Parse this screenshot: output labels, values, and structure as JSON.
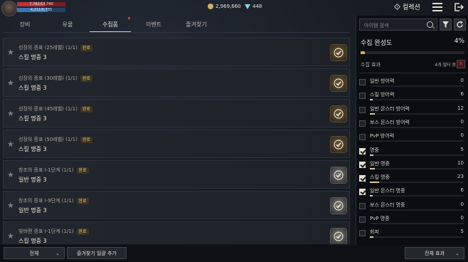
{
  "player": {
    "hp_text": "7,782/13,740",
    "mp_text": "4,211/6,735",
    "hp_ratio": 0.57,
    "mp_ratio": 0.63
  },
  "currency": {
    "gold": "2,969,660",
    "gems": "448"
  },
  "header": {
    "collection_label": "컬렉션"
  },
  "tabs": [
    {
      "label": "장비"
    },
    {
      "label": "유물"
    },
    {
      "label": "수집품",
      "active": true,
      "alert": true
    },
    {
      "label": "이벤트"
    },
    {
      "label": "즐겨찾기"
    }
  ],
  "items": [
    {
      "title": "성장의 증표 (25레벨) (1/1)",
      "badge": "완료",
      "effect": "스킬 명중 3",
      "icon": "gold"
    },
    {
      "title": "성장의 증표 (30레벨) (1/1)",
      "badge": "완료",
      "effect": "스킬 명중 3",
      "icon": "gold"
    },
    {
      "title": "성장의 증표 (45레벨) (1/1)",
      "badge": "완료",
      "effect": "스킬 명중 3",
      "icon": "gold"
    },
    {
      "title": "성장의 증표 (50레벨) (1/1)",
      "badge": "완료",
      "effect": "스킬 명중 3",
      "icon": "gold"
    },
    {
      "title": "창조의 증표 I-1단계 (1/1)",
      "badge": "완료",
      "effect": "일반 명중 3",
      "icon": "gray"
    },
    {
      "title": "창조의 증표 I-9단계 (1/1)",
      "badge": "완료",
      "effect": "일반 명중 3",
      "icon": "gray"
    },
    {
      "title": "빛바랜 증표 I-1단계 (1/1)",
      "badge": "완료",
      "effect": "스킬 명중 3",
      "icon": "gray"
    }
  ],
  "bottom": {
    "filter_all": "전체",
    "add_favorites": "즐겨찾기 일괄 추가",
    "all_effects": "전체 효과"
  },
  "panel": {
    "search_placeholder": "아이템 검색",
    "completion_label": "수집 완성도",
    "completion_pct": "4%",
    "completion_ratio": 0.04,
    "effects_label": "수집 효과",
    "filter_count_label": "4개 필터 중",
    "effects": [
      {
        "label": "일반 방어력",
        "value": "0",
        "checked": false,
        "ratio": 0
      },
      {
        "label": "스킬 방어력",
        "value": "6",
        "checked": false,
        "ratio": 0.03
      },
      {
        "label": "일반 몬스터 방어력",
        "value": "12",
        "checked": false,
        "ratio": 0.05
      },
      {
        "label": "보스 몬스터 방어력",
        "value": "0",
        "checked": false,
        "ratio": 0
      },
      {
        "label": "PvP 방어력",
        "value": "0",
        "checked": false,
        "ratio": 0
      },
      {
        "label": "명중",
        "value": "5",
        "checked": true,
        "ratio": 0.04
      },
      {
        "label": "일반 명중",
        "value": "10",
        "checked": true,
        "ratio": 0.05
      },
      {
        "label": "스킬 명중",
        "value": "23",
        "checked": true,
        "ratio": 0.1
      },
      {
        "label": "일반 몬스터 명중",
        "value": "6",
        "checked": true,
        "ratio": 0.03
      },
      {
        "label": "보스 몬스터 명중",
        "value": "0",
        "checked": false,
        "ratio": 0
      },
      {
        "label": "PvP 명중",
        "value": "0",
        "checked": false,
        "ratio": 0
      },
      {
        "label": "회피",
        "value": "5",
        "checked": false,
        "ratio": 0.04
      }
    ]
  }
}
